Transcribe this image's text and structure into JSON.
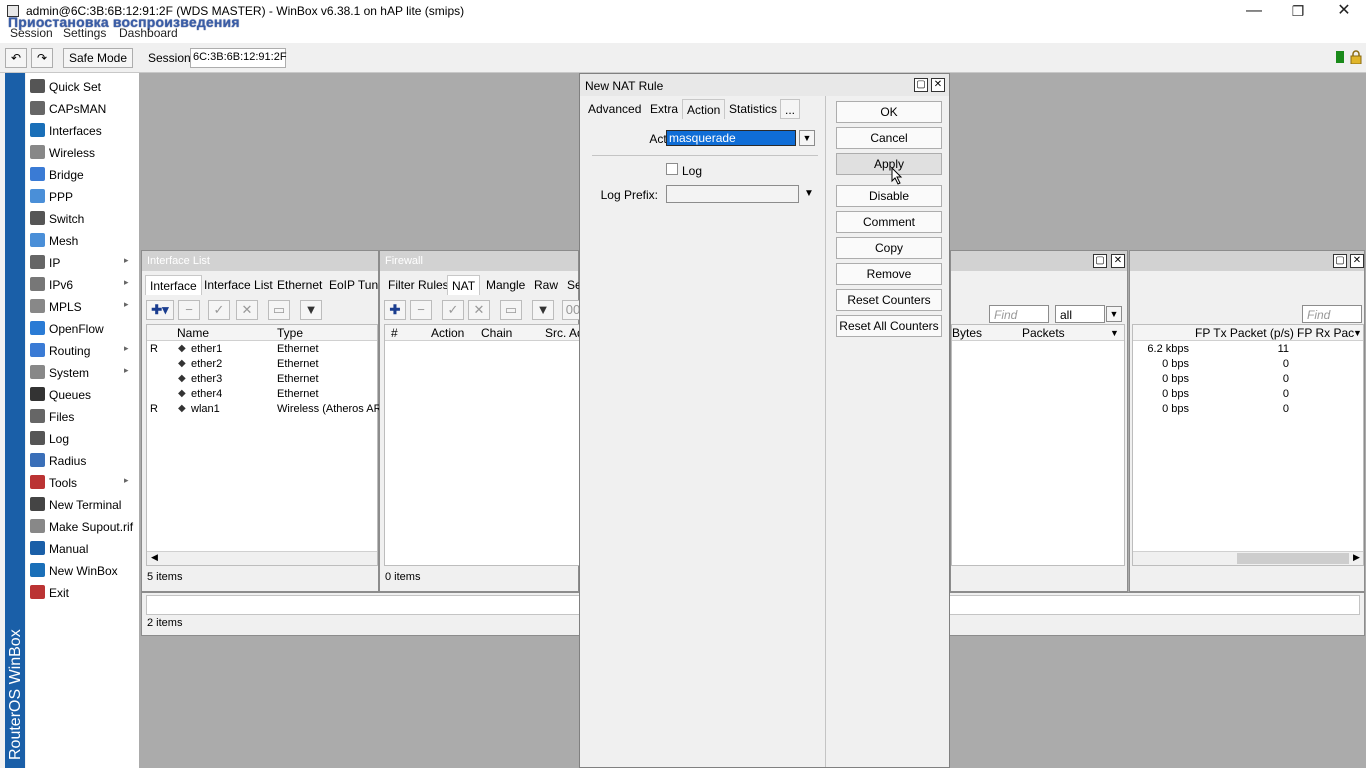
{
  "window": {
    "title": "admin@6C:3B:6B:12:91:2F (WDS MASTER) - WinBox v6.38.1 on hAP lite (smips)",
    "overlay": "Приостановка воспроизведения",
    "min": "—",
    "restore": "❐",
    "close": "✕"
  },
  "menu": [
    "Session",
    "Settings",
    "Dashboard"
  ],
  "toolbar": {
    "undo": "↶",
    "redo": "↷",
    "safe_mode": "Safe Mode",
    "session_label": "Session:",
    "session_value": "6C:3B:6B:12:91:2F"
  },
  "brand": "RouterOS WinBox",
  "sidebar": [
    {
      "label": "Quick Set",
      "icon": "quick-set-icon",
      "sub": false
    },
    {
      "label": "CAPsMAN",
      "icon": "capsman-icon",
      "sub": false
    },
    {
      "label": "Interfaces",
      "icon": "interfaces-icon",
      "sub": false
    },
    {
      "label": "Wireless",
      "icon": "wireless-icon",
      "sub": false
    },
    {
      "label": "Bridge",
      "icon": "bridge-icon",
      "sub": false
    },
    {
      "label": "PPP",
      "icon": "ppp-icon",
      "sub": false
    },
    {
      "label": "Switch",
      "icon": "switch-icon",
      "sub": false
    },
    {
      "label": "Mesh",
      "icon": "mesh-icon",
      "sub": false
    },
    {
      "label": "IP",
      "icon": "ip-icon",
      "sub": true
    },
    {
      "label": "IPv6",
      "icon": "ipv6-icon",
      "sub": true
    },
    {
      "label": "MPLS",
      "icon": "mpls-icon",
      "sub": true
    },
    {
      "label": "OpenFlow",
      "icon": "openflow-icon",
      "sub": false
    },
    {
      "label": "Routing",
      "icon": "routing-icon",
      "sub": true
    },
    {
      "label": "System",
      "icon": "system-icon",
      "sub": true
    },
    {
      "label": "Queues",
      "icon": "queues-icon",
      "sub": false
    },
    {
      "label": "Files",
      "icon": "files-icon",
      "sub": false
    },
    {
      "label": "Log",
      "icon": "log-icon",
      "sub": false
    },
    {
      "label": "Radius",
      "icon": "radius-icon",
      "sub": false
    },
    {
      "label": "Tools",
      "icon": "tools-icon",
      "sub": true
    },
    {
      "label": "New Terminal",
      "icon": "terminal-icon",
      "sub": false
    },
    {
      "label": "Make Supout.rif",
      "icon": "supout-icon",
      "sub": false
    },
    {
      "label": "Manual",
      "icon": "manual-icon",
      "sub": false
    },
    {
      "label": "New WinBox",
      "icon": "winbox-icon",
      "sub": false
    },
    {
      "label": "Exit",
      "icon": "exit-icon",
      "sub": false
    }
  ],
  "interface_list": {
    "title": "Interface List",
    "tabs": [
      "Interface",
      "Interface List",
      "Ethernet",
      "EoIP Tunnel"
    ],
    "columns": [
      "Name",
      "Type"
    ],
    "rows": [
      {
        "flag": "R",
        "name": "ether1",
        "type": "Ethernet"
      },
      {
        "flag": "",
        "name": "ether2",
        "type": "Ethernet"
      },
      {
        "flag": "",
        "name": "ether3",
        "type": "Ethernet"
      },
      {
        "flag": "",
        "name": "ether4",
        "type": "Ethernet"
      },
      {
        "flag": "R",
        "name": "wlan1",
        "type": "Wireless (Atheros AR9"
      }
    ],
    "status": "5 items"
  },
  "firewall": {
    "title": "Firewall",
    "tabs": [
      "Filter Rules",
      "NAT",
      "Mangle",
      "Raw",
      "Se"
    ],
    "columns": [
      "#",
      "Action",
      "Chain",
      "Src. Ad"
    ],
    "status": "0 items",
    "bottom_status": "2 items"
  },
  "right_panel": {
    "find": "Find",
    "filter": "all",
    "columns": [
      "Bytes",
      "Packets"
    ]
  },
  "far_right": {
    "find": "Find",
    "columns": [
      "FP Tx Packet (p/s)",
      "FP Rx Pac"
    ],
    "rows": [
      {
        "rate": "6.2 kbps",
        "packets": "11"
      },
      {
        "rate": "0 bps",
        "packets": "0"
      },
      {
        "rate": "0 bps",
        "packets": "0"
      },
      {
        "rate": "0 bps",
        "packets": "0"
      },
      {
        "rate": "0 bps",
        "packets": "0"
      }
    ]
  },
  "nat_dialog": {
    "title": "New NAT Rule",
    "tabs": [
      "Advanced",
      "Extra",
      "Action",
      "Statistics",
      "..."
    ],
    "action_label": "Action:",
    "action_value": "masquerade",
    "log_label": "Log",
    "log_prefix_label": "Log Prefix:",
    "buttons": [
      "OK",
      "Cancel",
      "Apply",
      "Disable",
      "Comment",
      "Copy",
      "Remove",
      "Reset Counters",
      "Reset All Counters"
    ]
  }
}
